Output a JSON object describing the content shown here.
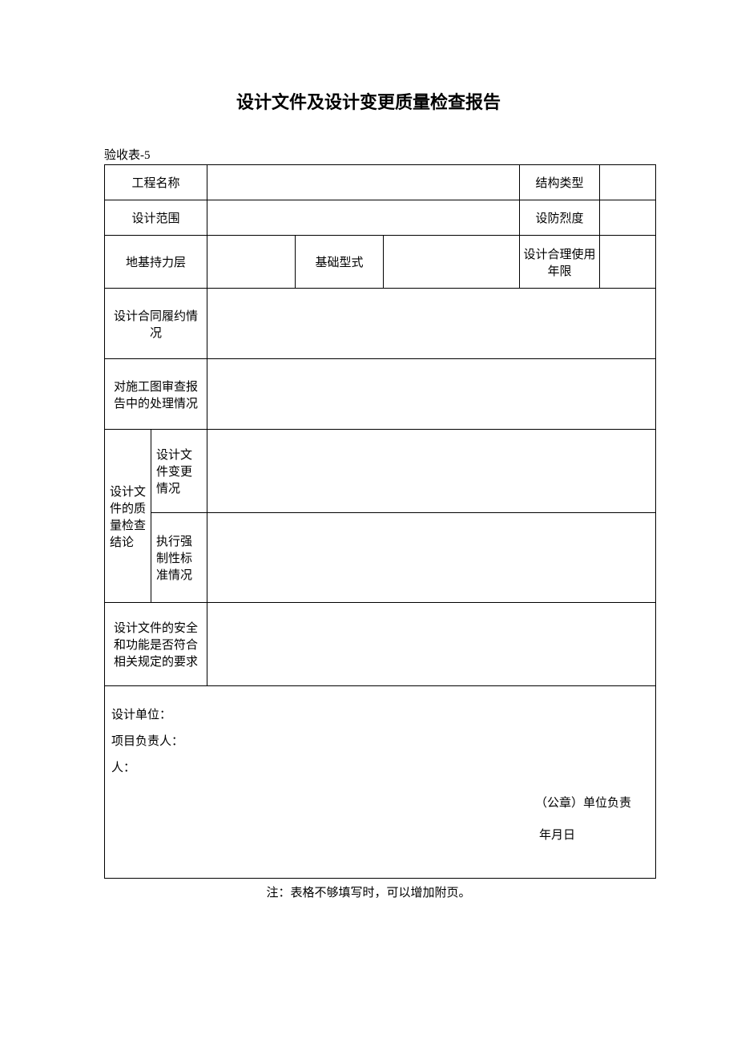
{
  "title": "设计文件及设计变更质量检查报告",
  "form_no": "验收表-5",
  "rows": {
    "r1": {
      "label1": "工程名称",
      "val1": "",
      "label2": "结构类型",
      "val2": ""
    },
    "r2": {
      "label1": "设计范围",
      "val1": "",
      "label2": "设防烈度",
      "val2": ""
    },
    "r3": {
      "label1": "地基持力层",
      "val1": "",
      "label2": "基础型式",
      "val2": "",
      "label3": "设计合理使用年限",
      "val3": ""
    },
    "r4": {
      "label": "设计合同履约情况",
      "val": ""
    },
    "r5": {
      "label": "对施工图审查报告中的处理情况",
      "val": ""
    },
    "r6": {
      "main": "设计文件的质量检查结论",
      "sub1": "设计文件变更情况",
      "val1": "",
      "sub2": "执行强制性标准情况",
      "val2": ""
    },
    "r7": {
      "label": "设计文件的安全和功能是否符合相关规定的要求",
      "val": ""
    }
  },
  "signature": {
    "unit": "设计单位：",
    "pm": "项目负责人：",
    "person": "人：",
    "seal": "（公章）单位负责",
    "date": "年月日"
  },
  "footnote": "注：表格不够填写时，可以增加附页。"
}
